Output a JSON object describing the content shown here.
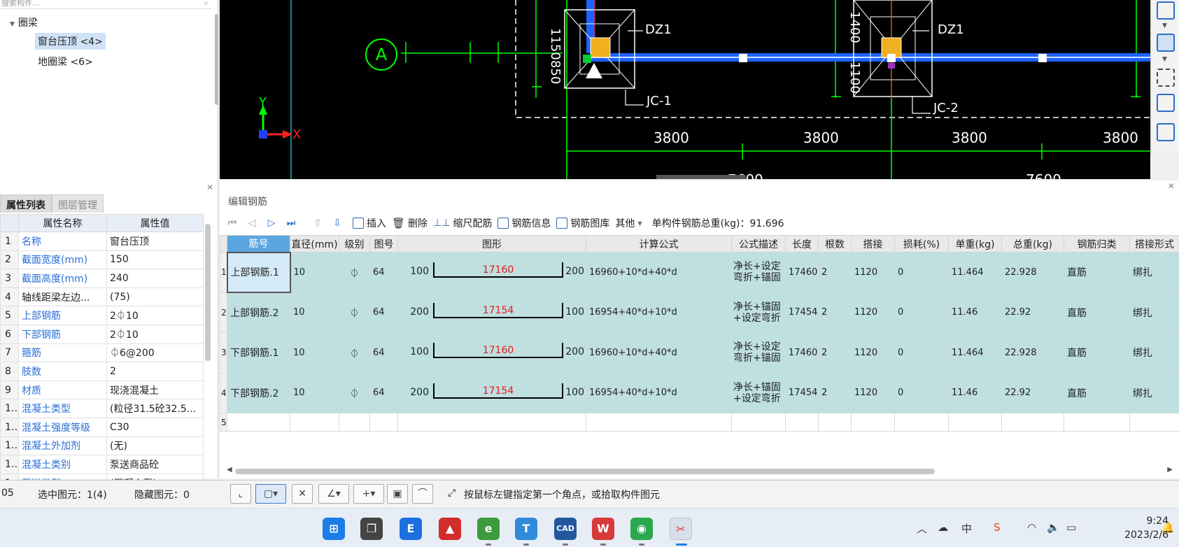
{
  "component_tree": {
    "search_placeholder": "搜索构件...",
    "root": "圈梁",
    "children": [
      "窗台压顶 <4>",
      "地圈梁 <6>"
    ]
  },
  "props_panel": {
    "tabs": [
      "属性列表",
      "图层管理"
    ],
    "col_name": "属性名称",
    "col_value": "属性值",
    "rows": [
      {
        "idx": "1",
        "name": "名称",
        "value": "窗台压顶",
        "blue": true
      },
      {
        "idx": "2",
        "name": "截面宽度(mm)",
        "value": "150",
        "blue": true
      },
      {
        "idx": "3",
        "name": "截面高度(mm)",
        "value": "240",
        "blue": true
      },
      {
        "idx": "4",
        "name": "轴线距梁左边...",
        "value": "(75)",
        "blue": false
      },
      {
        "idx": "5",
        "name": "上部钢筋",
        "value": "2⏀10",
        "blue": true
      },
      {
        "idx": "6",
        "name": "下部钢筋",
        "value": "2⏀10",
        "blue": true
      },
      {
        "idx": "7",
        "name": "箍筋",
        "value": "⏀6@200",
        "blue": true
      },
      {
        "idx": "8",
        "name": "肢数",
        "value": "2",
        "blue": true
      },
      {
        "idx": "9",
        "name": "材质",
        "value": "现浇混凝土",
        "blue": true
      },
      {
        "idx": "10",
        "name": "混凝土类型",
        "value": "(粒径31.5砼32.5...",
        "blue": true
      },
      {
        "idx": "11",
        "name": "混凝土强度等级",
        "value": "C30",
        "blue": true
      },
      {
        "idx": "12",
        "name": "混凝土外加剂",
        "value": "(无)",
        "blue": true
      },
      {
        "idx": "13",
        "name": "混凝土类别",
        "value": "泵送商品砼",
        "blue": true
      },
      {
        "idx": "14",
        "name": "泵送类型",
        "value": "(混凝土泵)",
        "blue": true
      }
    ]
  },
  "cad": {
    "axis_a": "A",
    "labels": [
      "DZ1",
      "DZ1",
      "JC-1",
      "JC-2"
    ],
    "dims_v": [
      "1150",
      "850",
      "1400",
      "1100",
      "1400",
      "1100"
    ],
    "dims_h": [
      "3800",
      "3800",
      "3800",
      "3800"
    ],
    "dims_bottom": [
      "7600",
      "7600"
    ],
    "ucs_x": "X",
    "ucs_y": "Y"
  },
  "editor": {
    "title": "编辑钢筋",
    "toolbar": {
      "insert": "插入",
      "delete": "删除",
      "scale": "缩尺配筋",
      "info": "钢筋信息",
      "library": "钢筋图库",
      "other": "其他",
      "weight": "单构件钢筋总重(kg)：91.696"
    },
    "headers": [
      "筋号",
      "直径(mm)",
      "级别",
      "图号",
      "图形",
      "计算公式",
      "公式描述",
      "长度",
      "根数",
      "搭接",
      "损耗(%)",
      "单重(kg)",
      "总重(kg)",
      "钢筋归类",
      "搭接形式"
    ],
    "rows": [
      {
        "rn": "1",
        "name": "上部钢筋.1",
        "dia": "10",
        "grade": "⏀",
        "fig": "64",
        "l": "100",
        "m": "17160",
        "r": "200",
        "formula": "16960+10*d+40*d",
        "desc": "净长+设定弯折+锚固",
        "len": "17460",
        "count": "2",
        "lap": "1120",
        "loss": "0",
        "unit": "11.464",
        "total": "22.928",
        "cls": "直筋",
        "lapt": "绑扎"
      },
      {
        "rn": "2",
        "name": "上部钢筋.2",
        "dia": "10",
        "grade": "⏀",
        "fig": "64",
        "l": "200",
        "m": "17154",
        "r": "100",
        "formula": "16954+40*d+10*d",
        "desc": "净长+锚固+设定弯折",
        "len": "17454",
        "count": "2",
        "lap": "1120",
        "loss": "0",
        "unit": "11.46",
        "total": "22.92",
        "cls": "直筋",
        "lapt": "绑扎"
      },
      {
        "rn": "3",
        "name": "下部钢筋.1",
        "dia": "10",
        "grade": "⏀",
        "fig": "64",
        "l": "100",
        "m": "17160",
        "r": "200",
        "formula": "16960+10*d+40*d",
        "desc": "净长+设定弯折+锚固",
        "len": "17460",
        "count": "2",
        "lap": "1120",
        "loss": "0",
        "unit": "11.464",
        "total": "22.928",
        "cls": "直筋",
        "lapt": "绑扎"
      },
      {
        "rn": "4",
        "name": "下部钢筋.2",
        "dia": "10",
        "grade": "⏀",
        "fig": "64",
        "l": "200",
        "m": "17154",
        "r": "100",
        "formula": "16954+40*d+10*d",
        "desc": "净长+锚固+设定弯折",
        "len": "17454",
        "count": "2",
        "lap": "1120",
        "loss": "0",
        "unit": "11.46",
        "total": "22.92",
        "cls": "直筋",
        "lapt": "绑扎"
      }
    ],
    "empty_rn": "5"
  },
  "status": {
    "left": "05",
    "selected": "选中图元：1(4)",
    "hidden": "隐藏图元：0",
    "hint": "按鼠标左键指定第一个角点，或拾取构件图元"
  },
  "taskbar": {
    "time": "9:24",
    "date": "2023/2/6",
    "ime": "中"
  }
}
